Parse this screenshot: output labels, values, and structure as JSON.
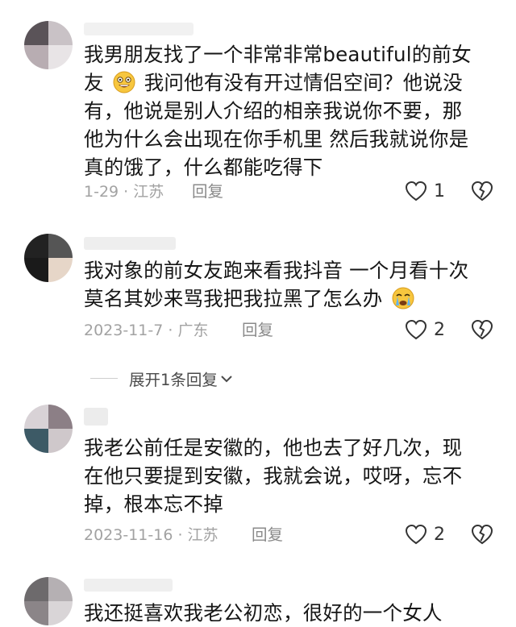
{
  "comments": [
    {
      "lines": [
        "我男朋友找了一个非常非常beautiful的前女",
        "友 {emoji} 我问他有没有开过情侣空间？他说没",
        "有，他说是别人介绍的相亲我说你不要，那",
        "他为什么会出现在你手机里 然后我就说你是",
        "真的饿了，什么都能吃得下"
      ],
      "line1": "我男朋友找了一个非常非常beautiful的前女",
      "line2a": "友",
      "line2b": "我问他有没有开过情侣空间？他说没",
      "line3": "有，他说是别人介绍的相亲我说你不要，那",
      "line4": "他为什么会出现在你手机里 然后我就说你是",
      "line5": "真的饿了，什么都能吃得下",
      "meta": "1-29 · 江苏",
      "reply": "回复",
      "likes": "1",
      "emoji": "grin-emoji"
    },
    {
      "line1": "我对象的前女友跑来看我抖音 一个月看十次",
      "line2": "莫名其妙来骂我把我拉黑了怎么办",
      "meta": "2023-11-7 · 广东",
      "reply": "回复",
      "likes": "2",
      "emoji": "crying-emoji"
    },
    {
      "line1": "我老公前任是安徽的，他也去了好几次，现",
      "line2": "在他只要提到安徽，我就会说，哎呀，忘不",
      "line3": "掉，根本忘不掉",
      "meta": "2023-11-16 · 江苏",
      "reply": "回复",
      "likes": "2"
    },
    {
      "line1": "我还挺喜欢我老公初恋，很好的一个女人"
    }
  ],
  "expand_label": "展开1条回复",
  "colors": {
    "text": "#161616",
    "meta": "#a2a2a2",
    "reply": "#8a8a8a"
  }
}
